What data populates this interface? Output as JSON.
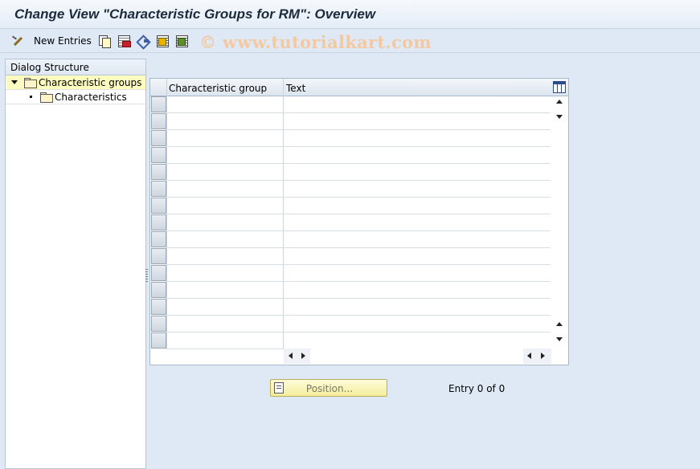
{
  "window": {
    "title": "Change View \"Characteristic Groups for RM\": Overview"
  },
  "toolbar": {
    "new_entries_label": "New Entries",
    "icons": [
      "pencil-icon",
      "copy-icon",
      "delete-icon",
      "undo-icon",
      "select-all-icon",
      "deselect-all-icon"
    ]
  },
  "watermark": {
    "text": "© www.tutorialkart.com"
  },
  "dialog_structure": {
    "heading": "Dialog Structure",
    "items": [
      {
        "label": "Characteristic groups",
        "selected": true,
        "expanded": true
      },
      {
        "label": "Characteristics",
        "selected": false,
        "level": 2
      }
    ]
  },
  "table": {
    "columns": [
      "Characteristic group",
      "Text"
    ],
    "visible_empty_rows": 15,
    "rows": []
  },
  "footer": {
    "position_button_label": "Position...",
    "entry_text": "Entry 0 of 0"
  },
  "colors": {
    "background": "#dfe9f5",
    "selected_tree_row": "#fffcc0",
    "watermark": "#f2c9a2",
    "position_button": "#f4ed9c"
  }
}
